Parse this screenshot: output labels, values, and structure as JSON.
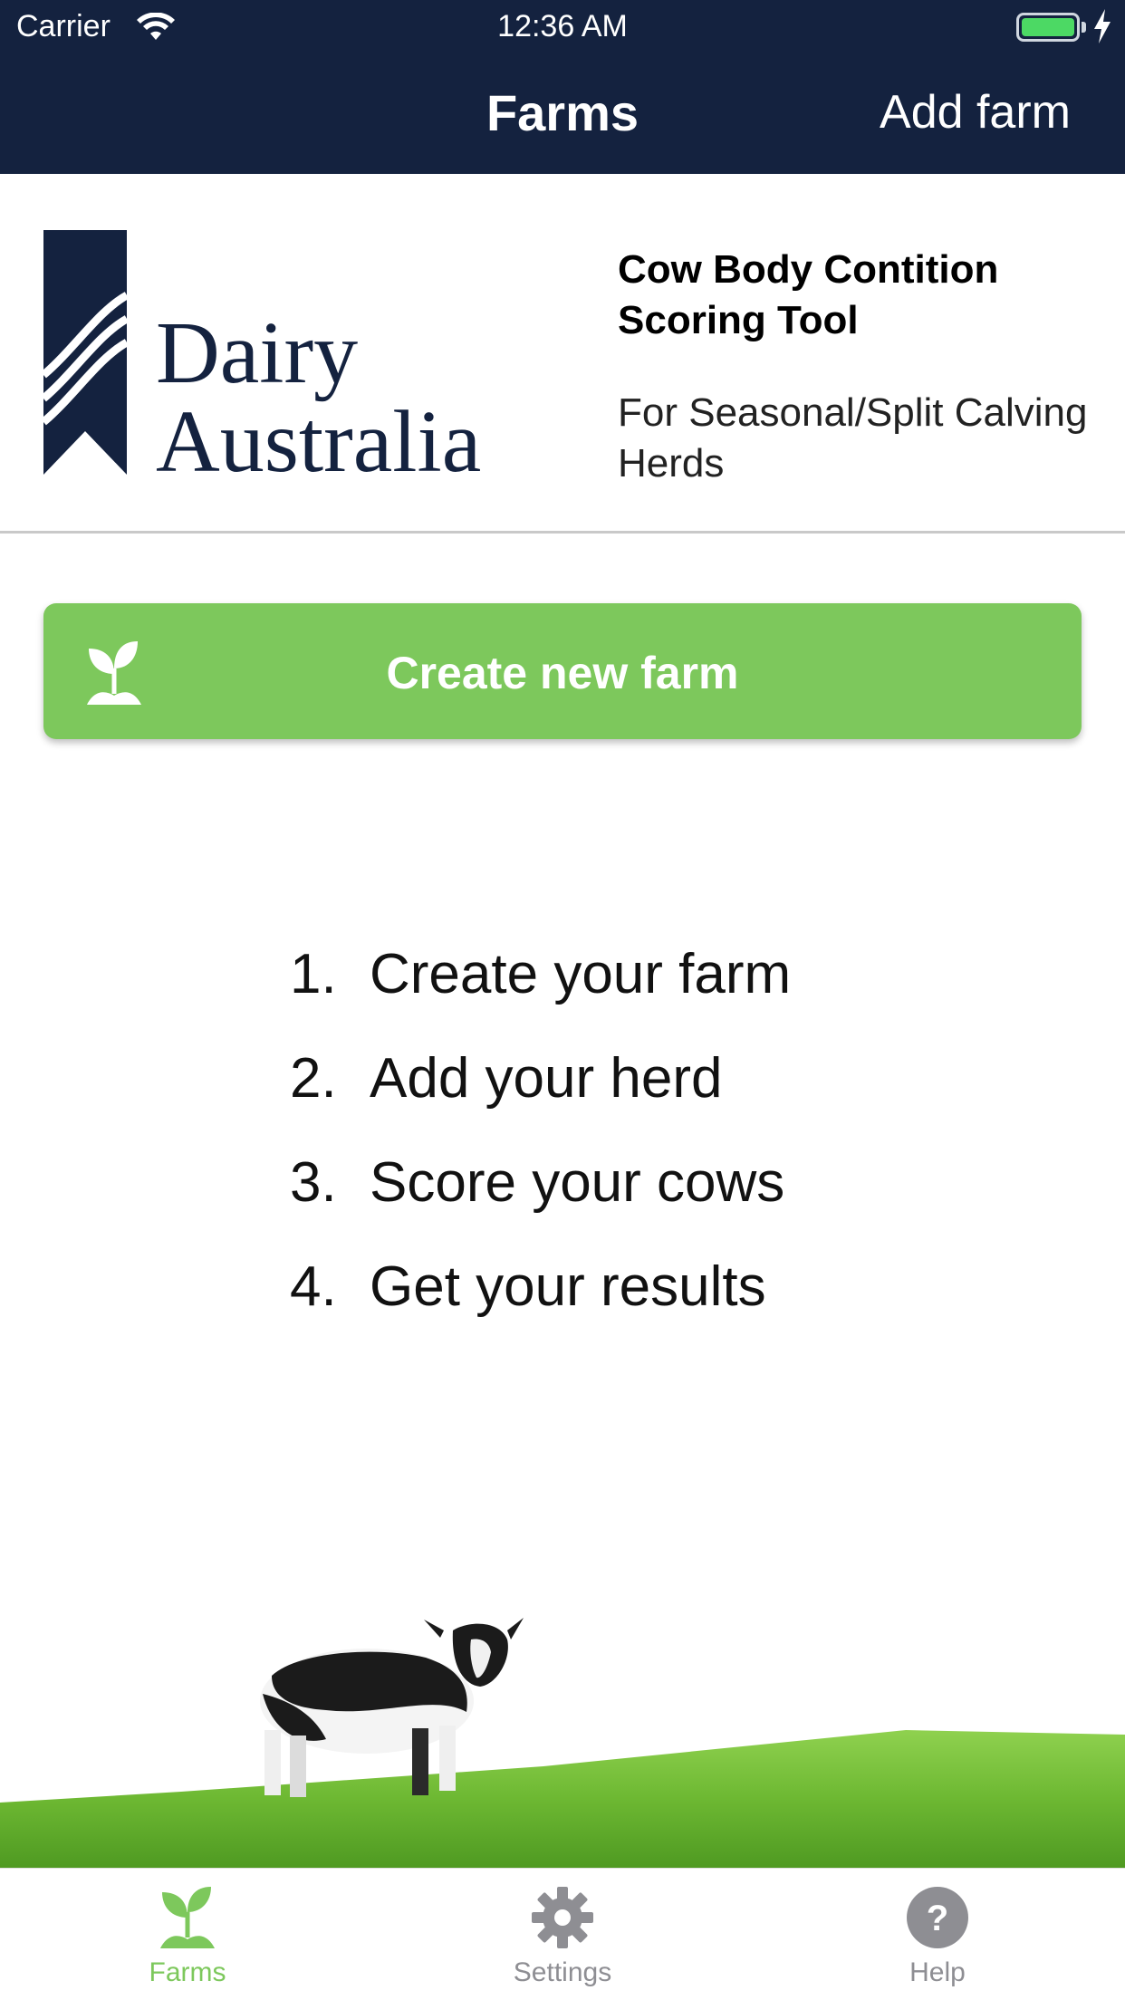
{
  "status_bar": {
    "carrier": "Carrier",
    "time": "12:36 AM",
    "battery_color": "#4cd964"
  },
  "nav": {
    "title": "Farms",
    "action_label": "Add farm",
    "background": "#14223f"
  },
  "brand": {
    "logo_text": "Dairy Australia",
    "logo_color": "#14223f",
    "tool_title": "Cow Body Contition Scoring Tool",
    "tool_subtitle": "For Seasonal/Split Calving Herds"
  },
  "create_button": {
    "label": "Create new farm",
    "icon": "sprout-icon",
    "color": "#7dc85c"
  },
  "steps": [
    {
      "num": "1.",
      "text": "Create your farm"
    },
    {
      "num": "2.",
      "text": "Add your herd"
    },
    {
      "num": "3.",
      "text": "Score your cows"
    },
    {
      "num": "4.",
      "text": "Get your results"
    }
  ],
  "tabs": [
    {
      "label": "Farms",
      "icon": "sprout-icon",
      "active": true
    },
    {
      "label": "Settings",
      "icon": "gear-icon",
      "active": false
    },
    {
      "label": "Help",
      "icon": "help-icon",
      "active": false
    }
  ],
  "colors": {
    "accent": "#7dc85c",
    "inactive": "#8e8e93"
  }
}
